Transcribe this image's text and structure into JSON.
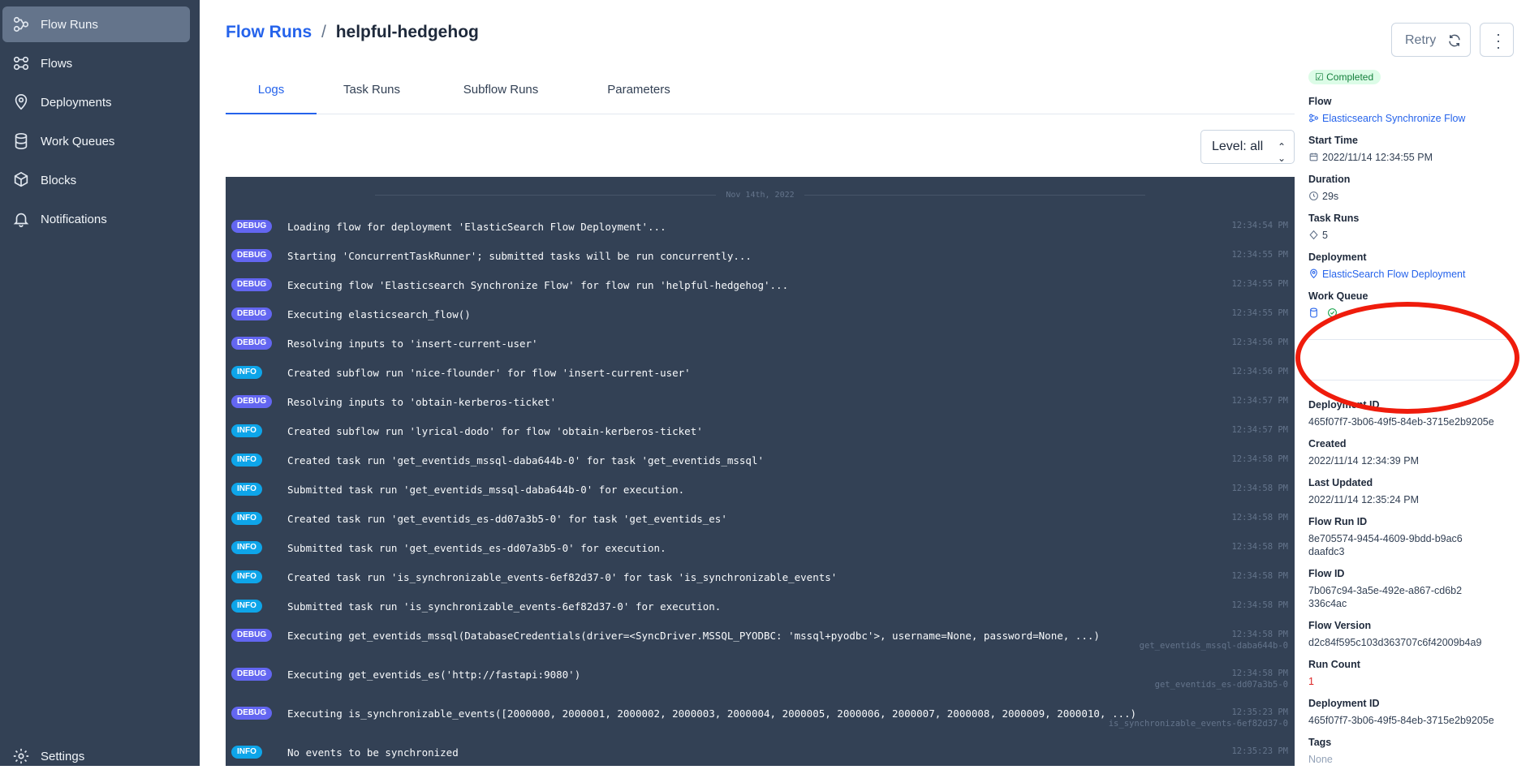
{
  "sidebar": {
    "items": [
      {
        "label": "Flow Runs",
        "icon": "flow-runs-icon",
        "active": true
      },
      {
        "label": "Flows",
        "icon": "flows-icon",
        "active": false
      },
      {
        "label": "Deployments",
        "icon": "map-pin-icon",
        "active": false
      },
      {
        "label": "Work Queues",
        "icon": "database-icon",
        "active": false
      },
      {
        "label": "Blocks",
        "icon": "cube-icon",
        "active": false
      },
      {
        "label": "Notifications",
        "icon": "bell-icon",
        "active": false
      }
    ],
    "settings": "Settings"
  },
  "breadcrumb": {
    "parent": "Flow Runs",
    "separator": "/",
    "current": "helpful-hedgehog"
  },
  "actions": {
    "retry": "Retry"
  },
  "tabs": [
    "Logs",
    "Task Runs",
    "Subflow Runs",
    "Parameters"
  ],
  "level_select": {
    "value": "Level: all"
  },
  "logs": {
    "date": "Nov 14th, 2022",
    "rows": [
      {
        "level": "DEBUG",
        "message": "Loading flow for deployment 'ElasticSearch Flow Deployment'...",
        "time": "12:34:54 PM",
        "task": ""
      },
      {
        "level": "DEBUG",
        "message": "Starting 'ConcurrentTaskRunner'; submitted tasks will be run concurrently...",
        "time": "12:34:55 PM",
        "task": ""
      },
      {
        "level": "DEBUG",
        "message": "Executing flow 'Elasticsearch Synchronize Flow' for flow run 'helpful-hedgehog'...",
        "time": "12:34:55 PM",
        "task": ""
      },
      {
        "level": "DEBUG",
        "message": "Executing elasticsearch_flow()",
        "time": "12:34:55 PM",
        "task": ""
      },
      {
        "level": "DEBUG",
        "message": "Resolving inputs to 'insert-current-user'",
        "time": "12:34:56 PM",
        "task": ""
      },
      {
        "level": "INFO",
        "message": "Created subflow run 'nice-flounder' for flow 'insert-current-user'",
        "time": "12:34:56 PM",
        "task": ""
      },
      {
        "level": "DEBUG",
        "message": "Resolving inputs to 'obtain-kerberos-ticket'",
        "time": "12:34:57 PM",
        "task": ""
      },
      {
        "level": "INFO",
        "message": "Created subflow run 'lyrical-dodo' for flow 'obtain-kerberos-ticket'",
        "time": "12:34:57 PM",
        "task": ""
      },
      {
        "level": "INFO",
        "message": "Created task run 'get_eventids_mssql-daba644b-0' for task 'get_eventids_mssql'",
        "time": "12:34:58 PM",
        "task": ""
      },
      {
        "level": "INFO",
        "message": "Submitted task run 'get_eventids_mssql-daba644b-0' for execution.",
        "time": "12:34:58 PM",
        "task": ""
      },
      {
        "level": "INFO",
        "message": "Created task run 'get_eventids_es-dd07a3b5-0' for task 'get_eventids_es'",
        "time": "12:34:58 PM",
        "task": ""
      },
      {
        "level": "INFO",
        "message": "Submitted task run 'get_eventids_es-dd07a3b5-0' for execution.",
        "time": "12:34:58 PM",
        "task": ""
      },
      {
        "level": "INFO",
        "message": "Created task run 'is_synchronizable_events-6ef82d37-0' for task 'is_synchronizable_events'",
        "time": "12:34:58 PM",
        "task": ""
      },
      {
        "level": "INFO",
        "message": "Submitted task run 'is_synchronizable_events-6ef82d37-0' for execution.",
        "time": "12:34:58 PM",
        "task": ""
      },
      {
        "level": "DEBUG",
        "message": "Executing get_eventids_mssql(DatabaseCredentials(driver=<SyncDriver.MSSQL_PYODBC: 'mssql+pyodbc'>, username=None, password=None, ...)",
        "time": "12:34:58 PM",
        "task": "get_eventids_mssql-daba644b-0"
      },
      {
        "level": "DEBUG",
        "message": "Executing get_eventids_es('http://fastapi:9080')",
        "time": "12:34:58 PM",
        "task": "get_eventids_es-dd07a3b5-0"
      },
      {
        "level": "DEBUG",
        "message": "Executing is_synchronizable_events([2000000, 2000001, 2000002, 2000003, 2000004, 2000005, 2000006, 2000007, 2000008, 2000009, 2000010, ...)",
        "time": "12:35:23 PM",
        "task": "is_synchronizable_events-6ef82d37-0"
      },
      {
        "level": "INFO",
        "message": "No events to be synchronized",
        "time": "12:35:23 PM",
        "task": ""
      }
    ]
  },
  "details": {
    "status": "Completed",
    "flow_label": "Flow",
    "flow": "Elasticsearch Synchronize Flow",
    "start_label": "Start Time",
    "start": "2022/11/14 12:34:55 PM",
    "duration_label": "Duration",
    "duration": "29s",
    "task_runs_label": "Task Runs",
    "task_runs": "5",
    "deployment_label": "Deployment",
    "deployment": "ElasticSearch Flow Deployment",
    "work_queue_label": "Work Queue",
    "deployment_id_label": "Deployment ID",
    "deployment_id": "465f07f7-3b06-49f5-84eb-3715e2b9205e",
    "created_label": "Created",
    "created": "2022/11/14 12:34:39 PM",
    "updated_label": "Last Updated",
    "updated": "2022/11/14 12:35:24 PM",
    "flow_run_id_label": "Flow Run ID",
    "flow_run_id": "8e705574-9454-4609-9bdd-b9ac6daafdc3",
    "flow_id_label": "Flow ID",
    "flow_id": "7b067c94-3a5e-492e-a867-cd6b2336c4ac",
    "flow_version_label": "Flow Version",
    "flow_version": "d2c84f595c103d363707c6f42009b4a9",
    "run_count_label": "Run Count",
    "run_count": "1",
    "deployment_id2_label": "Deployment ID",
    "deployment_id2": "465f07f7-3b06-49f5-84eb-3715e2b9205e",
    "tags_label": "Tags",
    "tags": "None"
  },
  "annotation": {
    "color": "#ef1c0c"
  }
}
